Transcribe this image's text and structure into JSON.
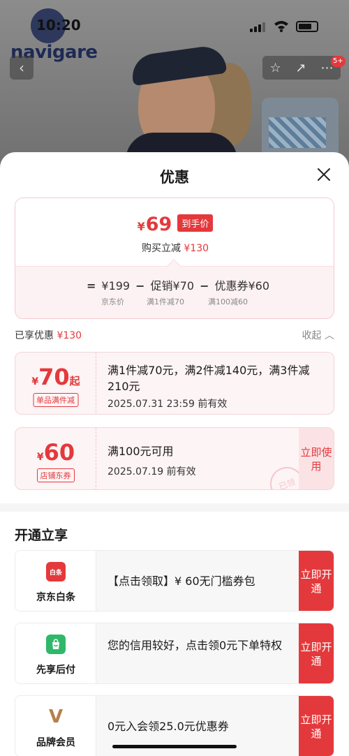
{
  "status_bar": {
    "time": "10:20"
  },
  "background": {
    "brand": "navigare",
    "notification_badge": "5+"
  },
  "sheet": {
    "title": "优惠",
    "final_price": {
      "yen": "¥",
      "amount": "69",
      "tag": "到手价",
      "reduce_label": "购买立减",
      "reduce_amount": "¥130"
    },
    "formula": {
      "equals": "=",
      "base_price": "¥199",
      "minus": "−",
      "promo": "促销¥70",
      "coupon": "优惠券¥60",
      "base_sub": "京东价",
      "promo_sub": "满1件减70",
      "coupon_sub": "满100减60"
    },
    "enjoyed": {
      "label": "已享优惠",
      "amount": "¥130",
      "collapse": "收起"
    },
    "coupons": [
      {
        "yen": "¥",
        "amount": "70",
        "suffix": "起",
        "label": "单品满件减",
        "desc": "满1件减70元，满2件减140元，满3件减210元",
        "date": "2025.07.31 23:59 前有效"
      },
      {
        "yen": "¥",
        "amount": "60",
        "suffix": "",
        "label": "店铺东券",
        "desc": "满100元可用",
        "date": "2025.07.19 前有效",
        "button": "立即使用",
        "stamp": "已领"
      }
    ],
    "open_section": {
      "title": "开通立享",
      "items": [
        {
          "icon": "白条",
          "name": "京东白条",
          "text": "【点击领取】¥ 60无门槛券包",
          "button": "立即开通",
          "color": "#e4393c"
        },
        {
          "icon": "",
          "name": "先享后付",
          "text": "您的信用较好，点击领0元下单特权",
          "button": "立即开通",
          "color": "#2fb86a"
        },
        {
          "icon": "V",
          "name": "品牌会员",
          "text": "0元入会领25.0元优惠券",
          "button": "立即开通",
          "color": "#b8804a"
        }
      ]
    }
  }
}
